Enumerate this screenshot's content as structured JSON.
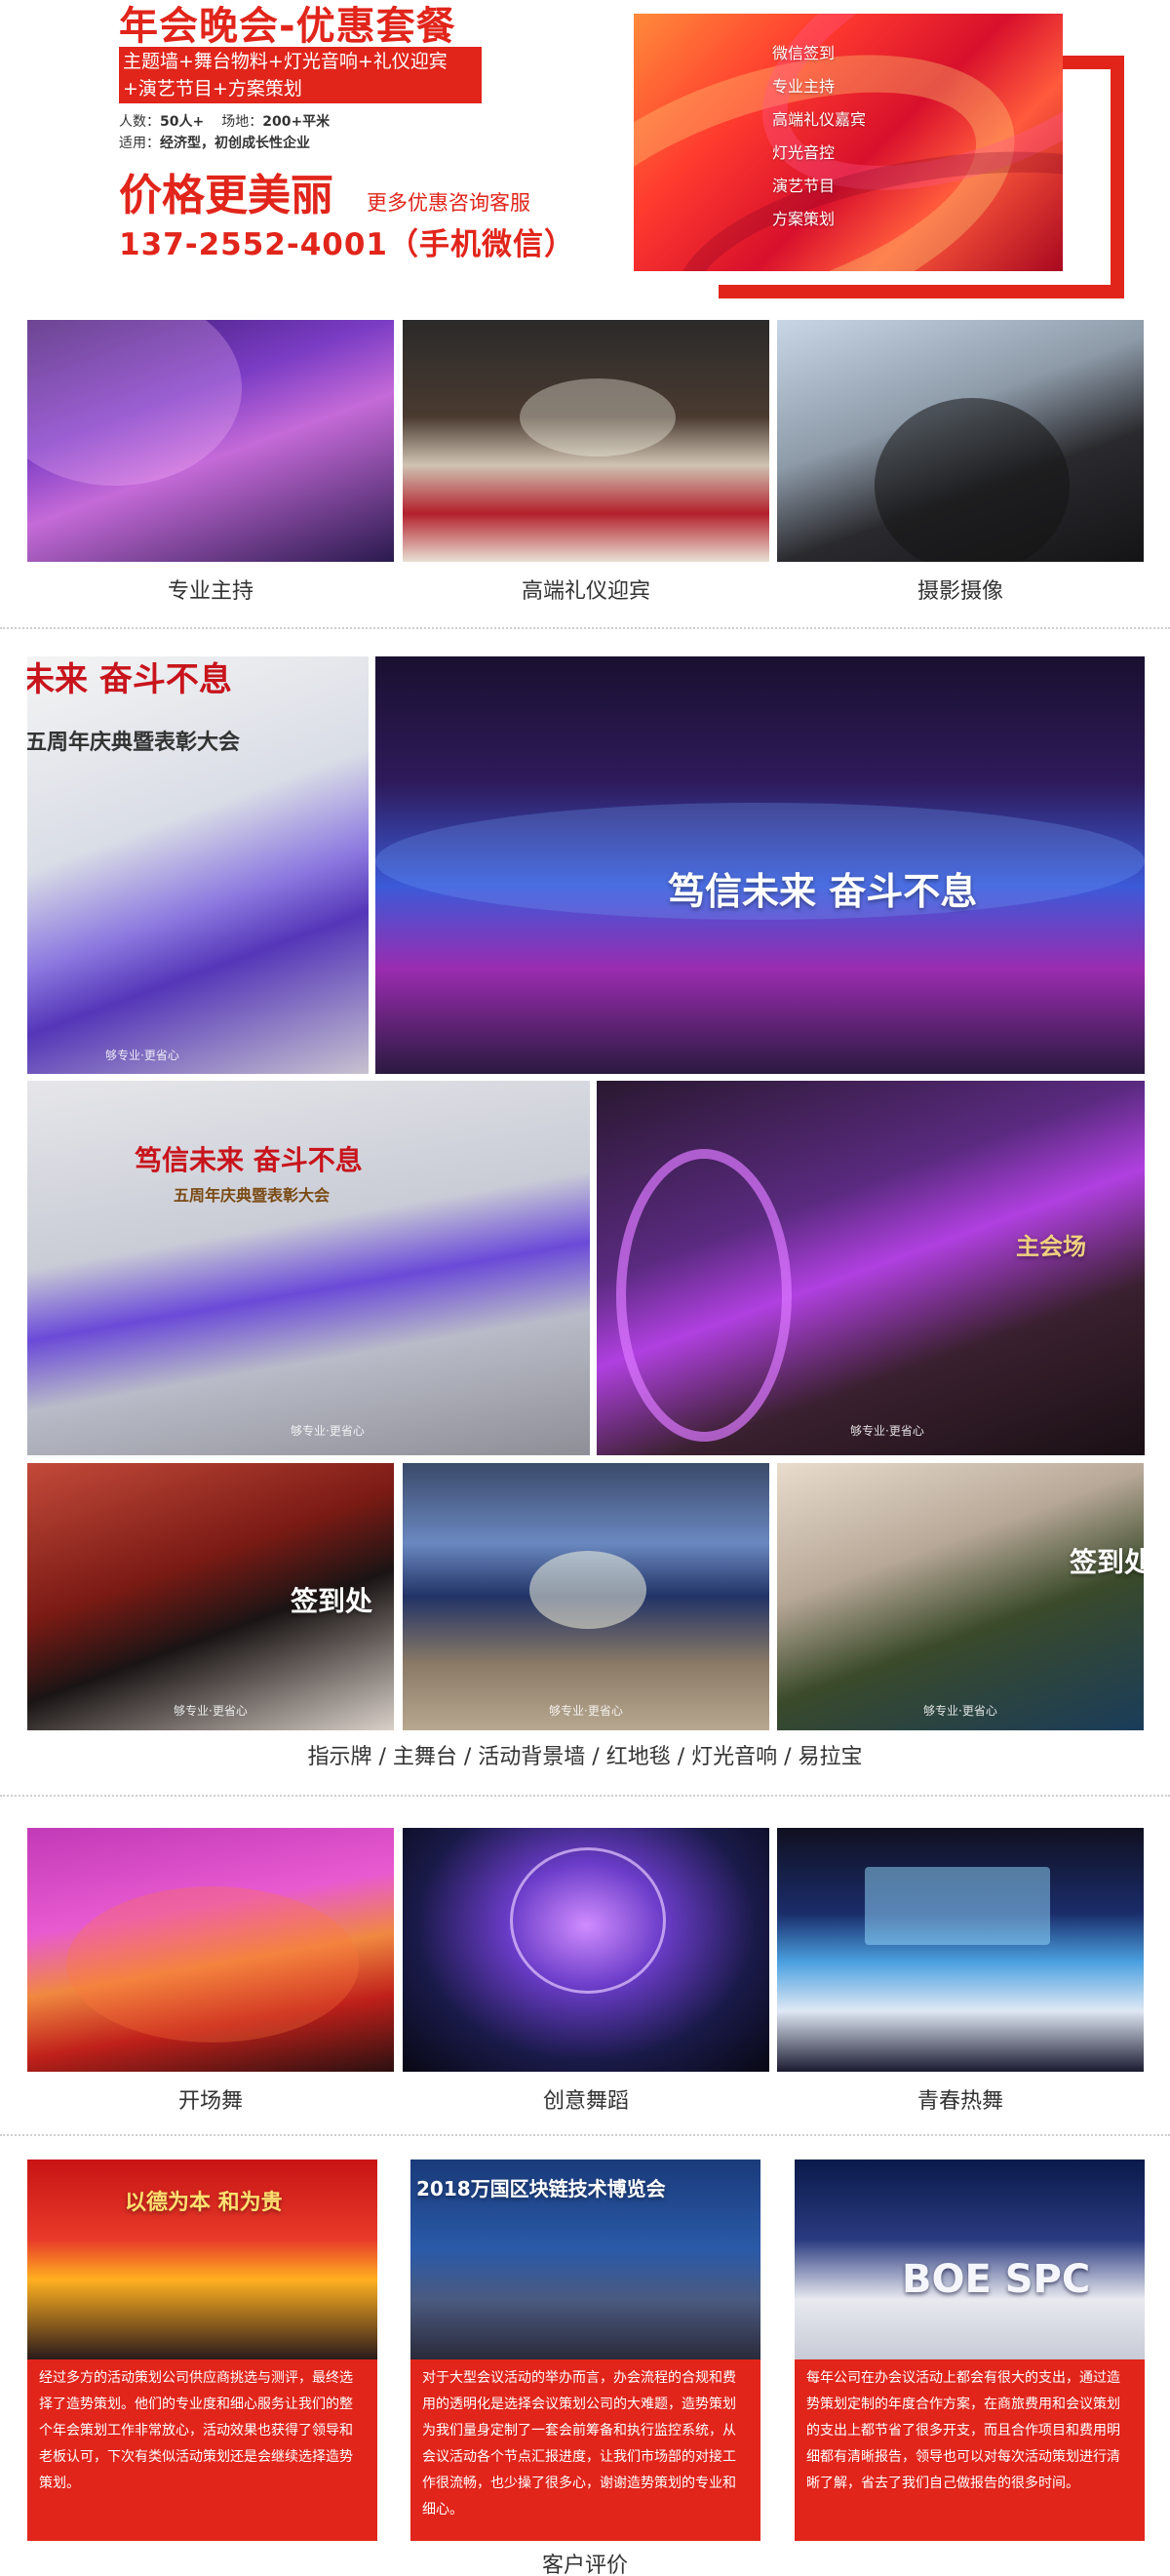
{
  "hero": {
    "title": "年会晚会-优惠套餐",
    "band_lines": [
      "主题墙+舞台物料+灯光音响+礼仪迎宾",
      "+演艺节目+方案策划"
    ],
    "meta": {
      "people_label": "人数：",
      "people_value": "50人+",
      "venue_label": "场地：",
      "venue_value": "200+平米",
      "suit_label": "适用：",
      "suit_value": "经济型，初创成长性企业"
    },
    "price_text": "价格更美丽",
    "more_text": "更多优惠咨询客服",
    "phone": "137-2552-4001（手机微信）",
    "services": [
      "微信签到",
      "专业主持",
      "高端礼仪嘉宾",
      "灯光音控",
      "演艺节目",
      "方案策划"
    ],
    "accent_color": "#e1251b"
  },
  "services_row": {
    "captions": [
      "专业主持",
      "高端礼仪迎宾",
      "摄影摄像"
    ]
  },
  "gallery": {
    "sign_text_1": "未来  奋斗不息",
    "sign_text_2": "五周年庆典暨表彰大会",
    "stage_text": "笃信未来  奋斗不息",
    "wall_text": "笃信未来  奋斗不息",
    "wall_sub": "五周年庆典暨表彰大会",
    "gate_text": "主会场",
    "pens_text": "签到处",
    "roses_text": "签到处",
    "watermark": "够专业·更省心",
    "caption": "指示牌 / 主舞台 / 活动背景墙 / 红地毯 / 灯光音响 / 易拉宝"
  },
  "shows": {
    "captions": [
      "开场舞",
      "创意舞蹈",
      "青春热舞"
    ]
  },
  "cases": {
    "image_texts": [
      "以德为本  和为贵",
      "2018万国区块链技术博览会",
      "BOE SPC"
    ],
    "descriptions": [
      "经过多方的活动策划公司供应商挑选与测评，最终选择了造势策划。他们的专业度和细心服务让我们的整个年会策划工作非常放心，活动效果也获得了领导和老板认可，下次有类似活动策划还是会继续选择造势策划。",
      "对于大型会议活动的举办而言，办会流程的合规和费用的透明化是选择会议策划公司的大难题，造势策划为我们量身定制了一套会前筹备和执行监控系统，从会议活动各个节点汇报进度，让我们市场部的对接工作很流畅，也少操了很多心，谢谢造势策划的专业和细心。",
      "每年公司在办会议活动上都会有很大的支出，通过造势策划定制的年度合作方案，在商旅费用和会议策划的支出上都节省了很多开支，而且合作项目和费用明细都有清晰报告，领导也可以对每次活动策划进行清晰了解，省去了我们自己做报告的很多时间。"
    ],
    "section_title": "客户评价"
  }
}
